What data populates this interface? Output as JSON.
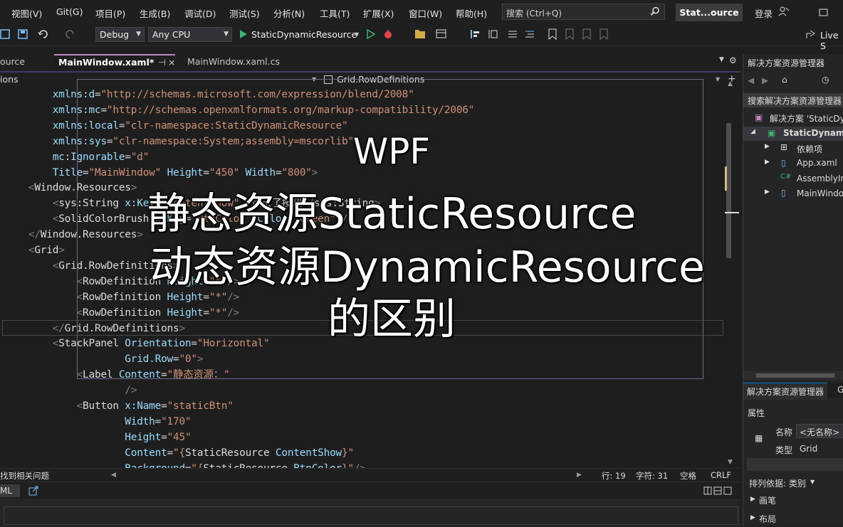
{
  "menu": [
    "视图(V)",
    "Git(G)",
    "项目(P)",
    "生成(B)",
    "调试(D)",
    "测试(S)",
    "分析(N)",
    "工具(T)",
    "扩展(X)",
    "窗口(W)",
    "帮助(H)"
  ],
  "search": {
    "label": "搜索 (Ctrl+Q)"
  },
  "project_badge": "Stat...ource",
  "login": "登录",
  "toolbar": {
    "config": "Debug",
    "platform": "Any CPU",
    "start_target": "StaticDynamicResource",
    "live_share": "Live S"
  },
  "tabs": [
    "ource",
    "MainWindow.xaml*",
    "MainWindow.xaml.cs"
  ],
  "navbar": {
    "left": "ions",
    "center": "Grid.RowDefinitions"
  },
  "status": {
    "issues": "找到相关问题",
    "line": "行: 19",
    "char": "字符: 31",
    "spaces": "空格",
    "eol": "CRLF"
  },
  "bottom": {
    "left": "ML"
  },
  "solution_explorer": {
    "title": "解决方案资源管理器",
    "search": "搜索解决方案资源管理器",
    "solution": "解决方案 'StaticDy",
    "project": "StaticDynami",
    "items": [
      "依赖项",
      "App.xaml",
      "AssemblyIn",
      "MainWindo"
    ],
    "tab": "解决方案资源管理器",
    "tab2": "G"
  },
  "properties": {
    "title": "属性",
    "name_label": "名称",
    "name_value": "<无名称>",
    "type_label": "类型",
    "type_value": "Grid",
    "sort": "排列依据: 类别",
    "groups": [
      "画笔",
      "布局"
    ]
  },
  "overlay": {
    "line1": "WPF",
    "line2": "静态资源StaticResource",
    "line3": "动态资源DynamicResource",
    "line4": "的区别"
  },
  "code": [
    {
      "indent": "        ",
      "parts": [
        [
          "a",
          "xmlns"
        ],
        [
          "w",
          ":"
        ],
        [
          "a",
          "d"
        ],
        [
          "w",
          "="
        ],
        [
          "v",
          "\"http://schemas.microsoft.com/expression/blend/2008\""
        ]
      ]
    },
    {
      "indent": "        ",
      "parts": [
        [
          "a",
          "xmlns"
        ],
        [
          "w",
          ":"
        ],
        [
          "a",
          "mc"
        ],
        [
          "w",
          "="
        ],
        [
          "v",
          "\"http://schemas.openxmlformats.org/markup-compatibility/2006\""
        ]
      ]
    },
    {
      "indent": "        ",
      "parts": [
        [
          "a",
          "xmlns"
        ],
        [
          "w",
          ":"
        ],
        [
          "a",
          "local"
        ],
        [
          "w",
          "="
        ],
        [
          "v",
          "\"clr-namespace:StaticDynamicResource\""
        ]
      ]
    },
    {
      "indent": "        ",
      "parts": [
        [
          "a",
          "xmlns"
        ],
        [
          "w",
          ":"
        ],
        [
          "a",
          "sys"
        ],
        [
          "w",
          "="
        ],
        [
          "v",
          "\"clr-namespace:System;assembly=mscorlib\""
        ]
      ]
    },
    {
      "indent": "        ",
      "parts": [
        [
          "a",
          "mc"
        ],
        [
          "w",
          ":"
        ],
        [
          "a",
          "Ignorable"
        ],
        [
          "w",
          "="
        ],
        [
          "v",
          "\"d\""
        ]
      ]
    },
    {
      "indent": "        ",
      "parts": [
        [
          "a",
          "Title"
        ],
        [
          "w",
          "="
        ],
        [
          "v",
          "\"MainWindow\""
        ],
        [
          "w",
          " "
        ],
        [
          "a",
          "Height"
        ],
        [
          "w",
          "="
        ],
        [
          "v",
          "\"450\""
        ],
        [
          "w",
          " "
        ],
        [
          "a",
          "Width"
        ],
        [
          "w",
          "="
        ],
        [
          "v",
          "\"800\""
        ],
        [
          "p",
          ">"
        ]
      ]
    },
    {
      "indent": "    ",
      "parts": [
        [
          "p",
          "<"
        ],
        [
          "w",
          "Window.Resources"
        ],
        [
          "p",
          ">"
        ]
      ]
    },
    {
      "indent": "        ",
      "parts": [
        [
          "p",
          "<"
        ],
        [
          "w",
          "sys:String "
        ],
        [
          "a",
          "x:Key"
        ],
        [
          "w",
          "="
        ],
        [
          "v",
          "\"ContentShow\""
        ],
        [
          "w",
          " "
        ],
        [
          "p",
          ">"
        ],
        [
          "w",
          "点击了按钮"
        ],
        [
          "p",
          "</"
        ],
        [
          "w",
          "sys:String"
        ],
        [
          "p",
          ">"
        ]
      ]
    },
    {
      "indent": "        ",
      "parts": [
        [
          "p",
          "<"
        ],
        [
          "w",
          "SolidColorBrush "
        ],
        [
          "a",
          "x:Key"
        ],
        [
          "w",
          "="
        ],
        [
          "v",
          "\"BtnColor\""
        ],
        [
          "w",
          " "
        ],
        [
          "a",
          "Color"
        ],
        [
          "w",
          "="
        ],
        [
          "v",
          "\"Green\""
        ],
        [
          "w",
          " "
        ],
        [
          "p",
          "/>"
        ]
      ]
    },
    {
      "indent": "    ",
      "parts": [
        [
          "p",
          "</"
        ],
        [
          "w",
          "Window.Resources"
        ],
        [
          "p",
          ">"
        ]
      ]
    },
    {
      "indent": "    ",
      "parts": [
        [
          "p",
          "<"
        ],
        [
          "w",
          "Grid"
        ],
        [
          "p",
          ">"
        ]
      ]
    },
    {
      "indent": "        ",
      "parts": [
        [
          "p",
          "<"
        ],
        [
          "w",
          "Grid.RowDefinitions"
        ],
        [
          "p",
          ">"
        ]
      ]
    },
    {
      "indent": "            ",
      "parts": [
        [
          "p",
          "<"
        ],
        [
          "w",
          "RowDefinition "
        ],
        [
          "a",
          "Height"
        ],
        [
          "w",
          "="
        ],
        [
          "v",
          "\"*\""
        ],
        [
          "p",
          "/>"
        ]
      ]
    },
    {
      "indent": "            ",
      "parts": [
        [
          "p",
          "<"
        ],
        [
          "w",
          "RowDefinition "
        ],
        [
          "a",
          "Height"
        ],
        [
          "w",
          "="
        ],
        [
          "v",
          "\"*\""
        ],
        [
          "p",
          "/>"
        ]
      ]
    },
    {
      "indent": "            ",
      "parts": [
        [
          "p",
          "<"
        ],
        [
          "w",
          "RowDefinition "
        ],
        [
          "a",
          "Height"
        ],
        [
          "w",
          "="
        ],
        [
          "v",
          "\"*\""
        ],
        [
          "p",
          "/>"
        ]
      ]
    },
    {
      "indent": "        ",
      "parts": [
        [
          "p",
          "</"
        ],
        [
          "w",
          "Grid.RowDefinitions"
        ],
        [
          "p",
          ">"
        ]
      ]
    },
    {
      "indent": "        ",
      "parts": [
        [
          "p",
          "<"
        ],
        [
          "w",
          "StackPanel "
        ],
        [
          "a",
          "Orientation"
        ],
        [
          "w",
          "="
        ],
        [
          "v",
          "\"Horizontal\""
        ]
      ]
    },
    {
      "indent": "                    ",
      "parts": [
        [
          "a",
          "Grid.Row"
        ],
        [
          "w",
          "="
        ],
        [
          "v",
          "\"0\""
        ],
        [
          "p",
          ">"
        ]
      ]
    },
    {
      "indent": "            ",
      "parts": [
        [
          "p",
          "<"
        ],
        [
          "w",
          "Label "
        ],
        [
          "a",
          "Content"
        ],
        [
          "w",
          "="
        ],
        [
          "v",
          "\"静态资源：\""
        ]
      ]
    },
    {
      "indent": "                    ",
      "parts": [
        [
          "p",
          "/>"
        ]
      ]
    },
    {
      "indent": "            ",
      "parts": [
        [
          "p",
          "<"
        ],
        [
          "w",
          "Button "
        ],
        [
          "a",
          "x:Name"
        ],
        [
          "w",
          "="
        ],
        [
          "v",
          "\"staticBtn\""
        ]
      ]
    },
    {
      "indent": "                    ",
      "parts": [
        [
          "a",
          "Width"
        ],
        [
          "w",
          "="
        ],
        [
          "v",
          "\"170\""
        ]
      ]
    },
    {
      "indent": "                    ",
      "parts": [
        [
          "a",
          "Height"
        ],
        [
          "w",
          "="
        ],
        [
          "v",
          "\"45\""
        ]
      ]
    },
    {
      "indent": "                    ",
      "parts": [
        [
          "a",
          "Content"
        ],
        [
          "w",
          "="
        ],
        [
          "v",
          "\"{"
        ],
        [
          "w",
          "StaticResource "
        ],
        [
          "a",
          "ContentShow"
        ],
        [
          "v",
          "}\""
        ]
      ]
    },
    {
      "indent": "                    ",
      "parts": [
        [
          "a",
          "Background"
        ],
        [
          "w",
          "="
        ],
        [
          "v",
          "\"{"
        ],
        [
          "w",
          "StaticResource "
        ],
        [
          "a",
          "BtnColor"
        ],
        [
          "v",
          "}\""
        ],
        [
          "p",
          "/>"
        ]
      ]
    }
  ]
}
